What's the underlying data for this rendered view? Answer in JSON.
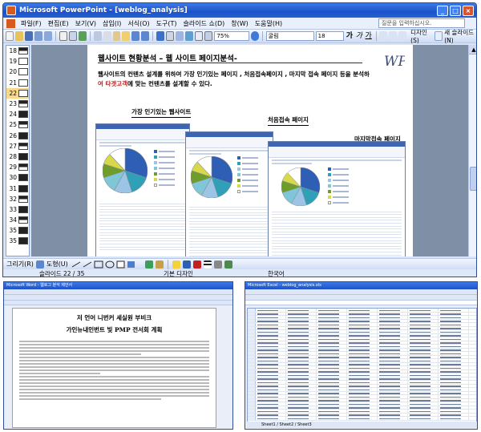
{
  "window": {
    "title": "Microsoft PowerPoint - [weblog_analysis]",
    "minimize": "_",
    "maximize": "□",
    "close": "×"
  },
  "menu": {
    "items": [
      "파일(F)",
      "편집(E)",
      "보기(V)",
      "삽입(I)",
      "서식(O)",
      "도구(T)",
      "슬라이드 쇼(D)",
      "창(W)",
      "도움말(H)"
    ],
    "help_placeholder": "질문을 입력하십시오."
  },
  "toolbar": {
    "zoom": "75%",
    "font": "굴림",
    "size": "18",
    "design_label": "디자인(S)",
    "new_slide_label": "새 슬라이드(N)"
  },
  "thumbnails": [
    "18",
    "19",
    "20",
    "21",
    "22",
    "23",
    "24",
    "25",
    "26",
    "27",
    "28",
    "29",
    "30",
    "31",
    "32",
    "33",
    "34",
    "35"
  ],
  "slide": {
    "title": "웹사이트 현황분석 – 웹 사이트 페이지분석-",
    "body_line1": "웹사이트의 컨텐츠 설계를 위하여 가장 인기있는 페이지 , 처음접속페이지 , 마지막 접속 페이지 등을 분석하",
    "body_line2_em": "여 타겟고객",
    "body_line2_rest": "에 맞는 컨텐츠를 설계할 수 있다.",
    "caption_popular": "가장 인기있는 웹사이트",
    "caption_first": "처음접속 페이지",
    "caption_last": "마지막접속 페이지",
    "logo": "WP"
  },
  "drawbar": {
    "draw_label": "그리기(R)",
    "autoshape_label": "도형(U)"
  },
  "status": {
    "slide": "슬라이드 22 / 35",
    "design": "기본 디자인",
    "language": "한국어"
  },
  "word_window": {
    "title": "Microsoft Word - 웹로그 분석 제안서",
    "heading1": "저 언어 니번커 세실원 부비크",
    "heading2": "가인뉴내인번트 빛 PMP 전서회 계획"
  },
  "excel_window": {
    "title": "Microsoft Excel - weblog_analysis.xls",
    "tabs": "Sheet1 / Sheet2 / Sheet3"
  },
  "colors": {
    "pie": [
      "#2f5fb5",
      "#30a0b8",
      "#9cc4e6",
      "#7fc6d6",
      "#6f9d2c",
      "#d7d94a",
      "#ffffff"
    ]
  }
}
